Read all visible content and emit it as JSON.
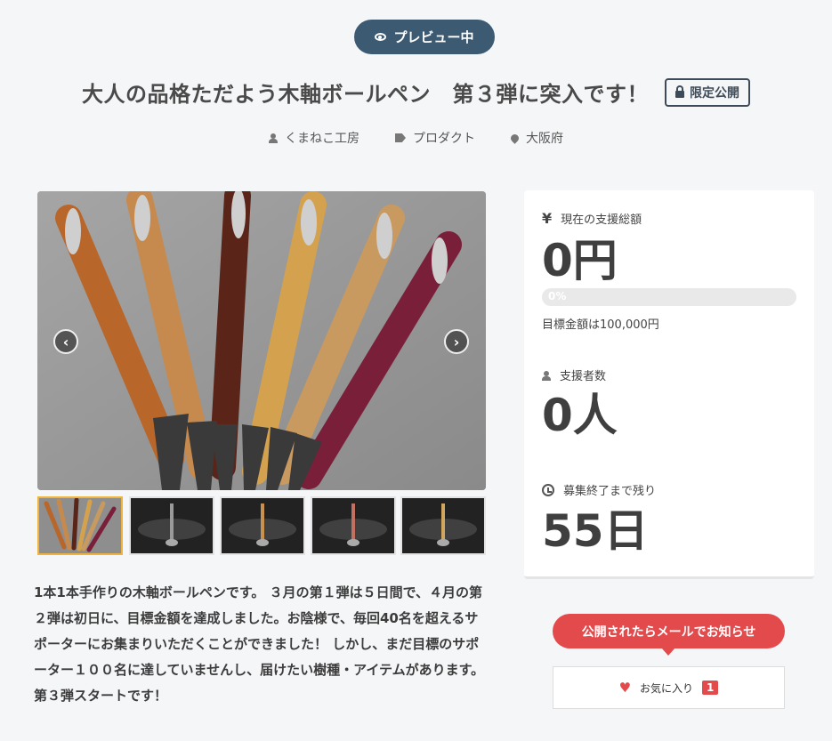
{
  "header": {
    "preview_label": "プレビュー中",
    "title": "大人の品格ただよう木軸ボールペン　第３弾に突入です！",
    "limited_label": "限定公開"
  },
  "meta": {
    "owner": "くまねこ工房",
    "category": "プロダクト",
    "location": "大阪府"
  },
  "gallery": {
    "image_count": 6,
    "selected_index": 0
  },
  "description": "1本1本手作りの木軸ボールペンです。 ３月の第１弾は５日間で、４月の第２弾は初日に、目標金額を達成しました。お陰様で、毎回40名を超えるサポーターにお集まりいただくことができました！ しかし、まだ目標のサポーター１００名に達していませんし、届けたい樹種・アイテムがあります。 第３弾スタートです！",
  "stats": {
    "amount_label": "現在の支援総額",
    "amount_value": "0円",
    "progress_text": "0%",
    "progress_fraction": 0,
    "goal_text": "目標金額は100,000円",
    "supporters_label": "支援者数",
    "supporters_value": "0人",
    "remaining_label": "募集終了まで残り",
    "remaining_value": "55日",
    "yen_symbol": "¥"
  },
  "actions": {
    "notify_label": "公開されたらメールでお知らせ",
    "favorite_label": "お気に入り",
    "favorite_count": "1"
  },
  "colors": {
    "accent_red": "#e34a4c",
    "badge_navy": "#3d5a73",
    "thumb_active": "#f0b43c"
  },
  "icons": {
    "preview": "eye-icon",
    "limited": "lock-icon",
    "owner": "user-icon",
    "category": "tag-icon",
    "location": "map-pin-icon",
    "amount": "yen-icon",
    "supporters": "user-icon",
    "remaining": "clock-icon",
    "favorite": "heart-icon",
    "prev": "chevron-left-icon",
    "next": "chevron-right-icon"
  }
}
